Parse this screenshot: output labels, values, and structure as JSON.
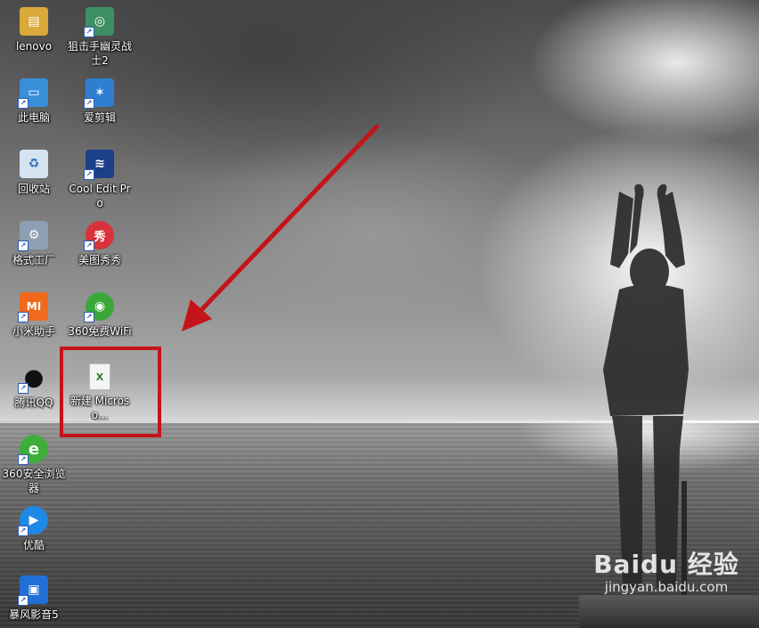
{
  "desktop_icons": [
    {
      "label": "lenovo",
      "icon": "folder-user-icon",
      "color": "#d9a93a"
    },
    {
      "label": "狙击手幽灵战士2",
      "icon": "sniper-game-icon",
      "color": "#3e8f63"
    },
    {
      "label": "此电脑",
      "icon": "computer-icon",
      "color": "#3a8fd9"
    },
    {
      "label": "爱剪辑",
      "icon": "video-editor-icon",
      "color": "#2f7fd1"
    },
    {
      "label": "回收站",
      "icon": "recycle-bin-icon",
      "color": "#d6e4f2"
    },
    {
      "label": "Cool Edit Pro",
      "icon": "audio-editor-icon",
      "color": "#1d3f8a"
    },
    {
      "label": "格式工厂",
      "icon": "format-factory-icon",
      "color": "#8e9fb4"
    },
    {
      "label": "美图秀秀",
      "icon": "meitu-icon",
      "color": "#d9323a"
    },
    {
      "label": "小米助手",
      "icon": "mi-assistant-icon",
      "color": "#f06a1d"
    },
    {
      "label": "360免费WiFi",
      "icon": "wifi-icon",
      "color": "#3aa839"
    },
    {
      "label": "腾讯QQ",
      "icon": "qq-penguin-icon",
      "color": "#222222"
    },
    {
      "label": "新建 Microso...",
      "icon": "excel-file-icon",
      "color": "#2e7d32"
    },
    {
      "label": "360安全浏览器",
      "icon": "browser-360-icon",
      "color": "#3dae3a"
    },
    {
      "label": "优酷",
      "icon": "youku-play-icon",
      "color": "#1e88e5"
    },
    {
      "label": "暴风影音5",
      "icon": "baofeng-player-icon",
      "color": "#1f6fd6"
    }
  ],
  "glyphs": {
    "lenovo": "▤",
    "sniper": "◎",
    "computer": "▭",
    "editor": "✶",
    "recycle": "♻",
    "audio": "≋",
    "format": "⚙",
    "meitu": "秀",
    "mi": "MI",
    "wifi": "◉",
    "qq": "●",
    "excel": "X",
    "browser": "e",
    "youku": "▶",
    "baofeng": "▣"
  },
  "watermark": {
    "brand": "Baidu 经验",
    "site": "jingyan.baidu.com"
  },
  "annotation_color": "#c4141a"
}
